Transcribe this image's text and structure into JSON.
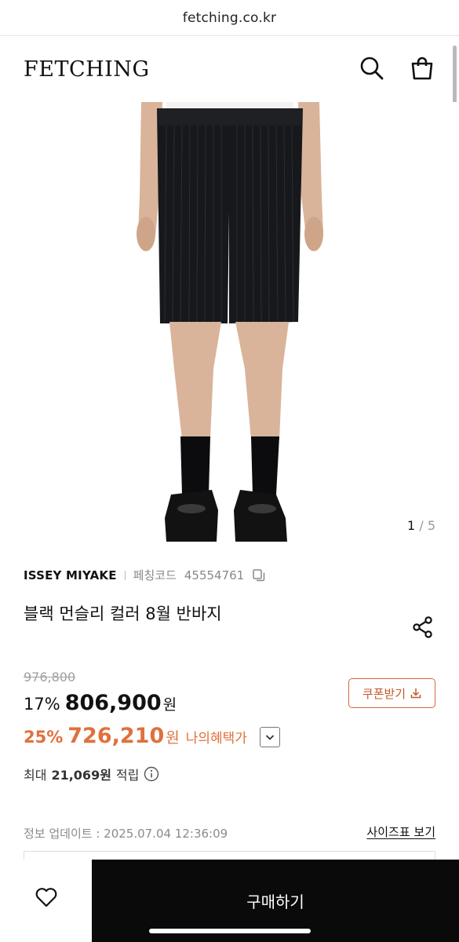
{
  "browser": {
    "url": "fetching.co.kr"
  },
  "header": {
    "logo": "FETCHING",
    "icons": [
      "search-icon",
      "shopping-bag-icon"
    ]
  },
  "gallery": {
    "current": "1",
    "separator": "/",
    "total": "5"
  },
  "product": {
    "brand": "ISSEY MIYAKE",
    "code_label": "페칭코드",
    "code": "45554761",
    "title": "블랙 먼슬리 컬러 8월 반바지"
  },
  "pricing": {
    "original_price": "976,800",
    "discount1": "17%",
    "price1": "806,900",
    "price1_unit": "원",
    "discount2": "25%",
    "price2": "726,210",
    "price2_unit": "원",
    "benefit_label": "나의혜택가",
    "coupon_label": "쿠폰받기",
    "points_prefix": "최대",
    "points_value": "21,069원",
    "points_suffix": "적립"
  },
  "info": {
    "update_text": "정보 업데이트 : 2025.07.04 12:36:09",
    "size_chart_link": "사이즈표 보기"
  },
  "bottom": {
    "buy_label": "구매하기"
  },
  "colors": {
    "accent": "#e0703c",
    "coupon": "#c5582a",
    "buy_bg": "#0a0a0a"
  }
}
